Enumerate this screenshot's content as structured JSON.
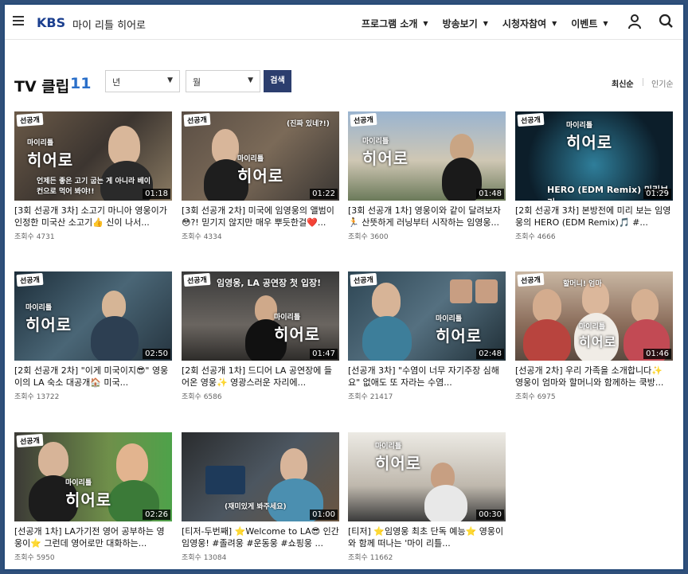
{
  "header": {
    "logo": "KBS",
    "program_title": "마이 리틀 히어로",
    "nav": [
      {
        "label": "프로그램 소개"
      },
      {
        "label": "방송보기"
      },
      {
        "label": "시청자참여"
      },
      {
        "label": "이벤트"
      }
    ]
  },
  "list": {
    "title": "TV 클립",
    "count": "11",
    "year_select": "년",
    "month_select": "월",
    "search_button": "검색",
    "sort_latest": "최신순",
    "sort_popular": "인기순"
  },
  "clips": [
    {
      "title": "[3회 선공개 3차] 소고기 마니아 영웅이가 인정한 미국산 소고기👍 신이 나서...",
      "views": "조회수 4731",
      "duration": "01:18",
      "tag": "선공개",
      "brand": "히어로",
      "caption": "언제든 좋은 고기 굽는 게 아니라 베이컨으로 먹어 봐야!!"
    },
    {
      "title": "[3회 선공개 2차] 미국에 임영웅의 앨범이😳?! 믿기지 않지만 매우 뿌듯한걸❤️...",
      "views": "조회수 4334",
      "duration": "01:22",
      "tag": "선공개",
      "brand": "히어로",
      "caption": "(진짜 있네?!)"
    },
    {
      "title": "[3회 선공개 1차] 영웅이와 같이 달려보자🏃 산뜻하게 러닝부터 시작하는 임영웅...",
      "views": "조회수 3600",
      "duration": "01:48",
      "tag": "선공개",
      "brand": "히어로",
      "caption": ""
    },
    {
      "title": "[2회 선공개 3차] 본방전에 미리 보는 임영웅의 HERO (EDM Remix)🎵 #...",
      "views": "조회수 4666",
      "duration": "01:29",
      "tag": "선공개",
      "brand": "히어로",
      "caption": "HERO (EDM Remix) 미리보기"
    },
    {
      "title": "[2회 선공개 2차] \"이게 미국이지😎\" 영웅이의 LA 숙소 대공개🏠 미국...",
      "views": "조회수 13722",
      "duration": "02:50",
      "tag": "선공개",
      "brand": "히어로",
      "caption": ""
    },
    {
      "title": "[2회 선공개 1차] 드디어 LA 공연장에 들어온 영웅✨ 영광스러운 자리에...",
      "views": "조회수 6586",
      "duration": "01:47",
      "tag": "선공개",
      "brand": "히어로",
      "caption": "임영웅, LA 공연장 첫 입장!"
    },
    {
      "title": "[선공개 3차] \"수염이 너무 자기주장 심해요\" 없애도 또 자라는 수염...",
      "views": "조회수 21417",
      "duration": "02:48",
      "tag": "선공개",
      "brand": "히어로",
      "caption": ""
    },
    {
      "title": "[선공개 2차] 우리 가족을 소개합니다✨ 영웅이 엄마와 할머니와 함께하는 쿡방...",
      "views": "조회수 6975",
      "duration": "01:46",
      "tag": "선공개",
      "brand": "히어로",
      "caption": "할머니! 엄마"
    },
    {
      "title": "[선공개 1차] LA가기전 영어 공부하는 영웅이⭐ 그런데 영어로만 대화하는...",
      "views": "조회수 5950",
      "duration": "02:26",
      "tag": "선공개",
      "brand": "히어로",
      "caption": ""
    },
    {
      "title": "[티저-두번째] ⭐Welcome to LA😎 인간 임영웅! #졸려웅 #운동웅 #쇼핑웅 ...",
      "views": "조회수 13084",
      "duration": "01:00",
      "tag": "",
      "brand": "",
      "caption": "(재미있게 봐주세요)"
    },
    {
      "title": "[티저] ⭐임영웅 최초 단독 예능⭐ 영웅이와 함께 떠나는 '마이 리틀...",
      "views": "조회수 11662",
      "duration": "00:30",
      "tag": "",
      "brand": "히어로",
      "caption": ""
    }
  ]
}
